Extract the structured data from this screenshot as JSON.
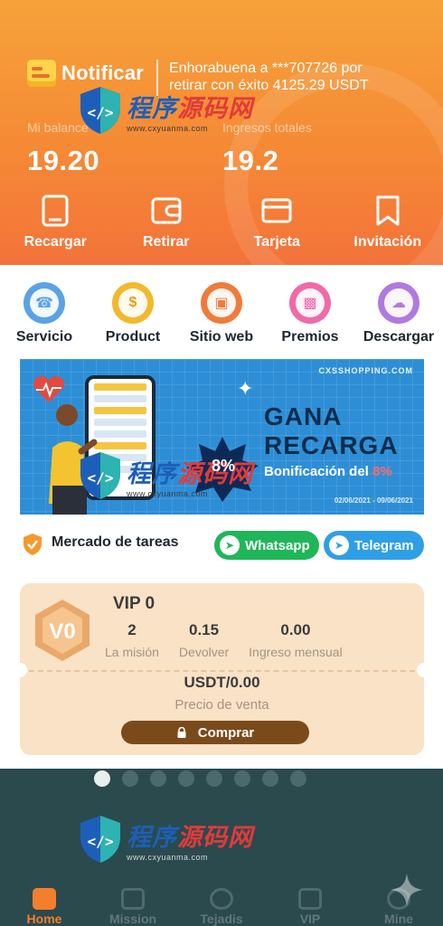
{
  "header": {
    "notify_label": "Notificar",
    "notify_message": "Enhorabuena a ***707726 por retirar con éxito 4125.29 USDT",
    "balance_label": "Mi balance",
    "balance_value": "19.20",
    "income_label": "Ingresos totales",
    "income_value": "19.2",
    "actions": [
      {
        "label": "Recargar",
        "icon": "tablet-icon"
      },
      {
        "label": "Retirar",
        "icon": "wallet-icon"
      },
      {
        "label": "Tarjeta",
        "icon": "card-icon"
      },
      {
        "label": "Invitación",
        "icon": "bookmark-icon"
      }
    ]
  },
  "shortcuts": [
    {
      "label": "Servicio",
      "icon": "headset-icon",
      "color": "#5aa2e8"
    },
    {
      "label": "Product",
      "icon": "dollar-coin-icon",
      "color": "#f2b92c"
    },
    {
      "label": "Sitio web",
      "icon": "globe-icon",
      "color": "#f07b3a"
    },
    {
      "label": "Premios",
      "icon": "gift-icon",
      "color": "#f06aa8"
    },
    {
      "label": "Descargar",
      "icon": "cloud-download-icon",
      "color": "#b07ae0"
    }
  ],
  "banner": {
    "site": "CXSSHOPPING.COM",
    "title_line1": "GANA",
    "title_line2": "RECARGA",
    "subtitle": "Bonificación del",
    "subtitle_pct": "8%",
    "percent": "8%",
    "dates": "02/06/2021 - 09/06/2021"
  },
  "tasks": {
    "title": "Mercado de tareas",
    "whatsapp": "Whatsapp",
    "telegram": "Telegram"
  },
  "vip": {
    "badge": "V0",
    "name": "VIP 0",
    "stats": [
      {
        "value": "2",
        "label": "La misión"
      },
      {
        "value": "0.15",
        "label": "Devolver"
      },
      {
        "value": "0.00",
        "label": "Ingreso mensual"
      }
    ],
    "price": "USDT/0.00",
    "price_label": "Precio de venta",
    "buy_label": "Comprar"
  },
  "carousel": {
    "count": 8,
    "active_index": 0
  },
  "tabbar": [
    {
      "label": "Home",
      "icon": "home-icon",
      "active": true
    },
    {
      "label": "Mission",
      "icon": "mission-icon",
      "active": false
    },
    {
      "label": "Tejadis",
      "icon": "chart-icon",
      "active": false
    },
    {
      "label": "VIP",
      "icon": "vip-icon",
      "active": false
    },
    {
      "label": "Mine",
      "icon": "user-icon",
      "active": false
    }
  ],
  "watermark": {
    "main_a": "程序",
    "main_b": "源码网",
    "url": "www.cxyuanma.com"
  },
  "colors": {
    "header_orange": "#f58a35",
    "accent": "#f57e2c",
    "vip_card": "#fae2c6",
    "buy_button": "#7b4a1b",
    "dark_section": "#2a4a4e"
  }
}
